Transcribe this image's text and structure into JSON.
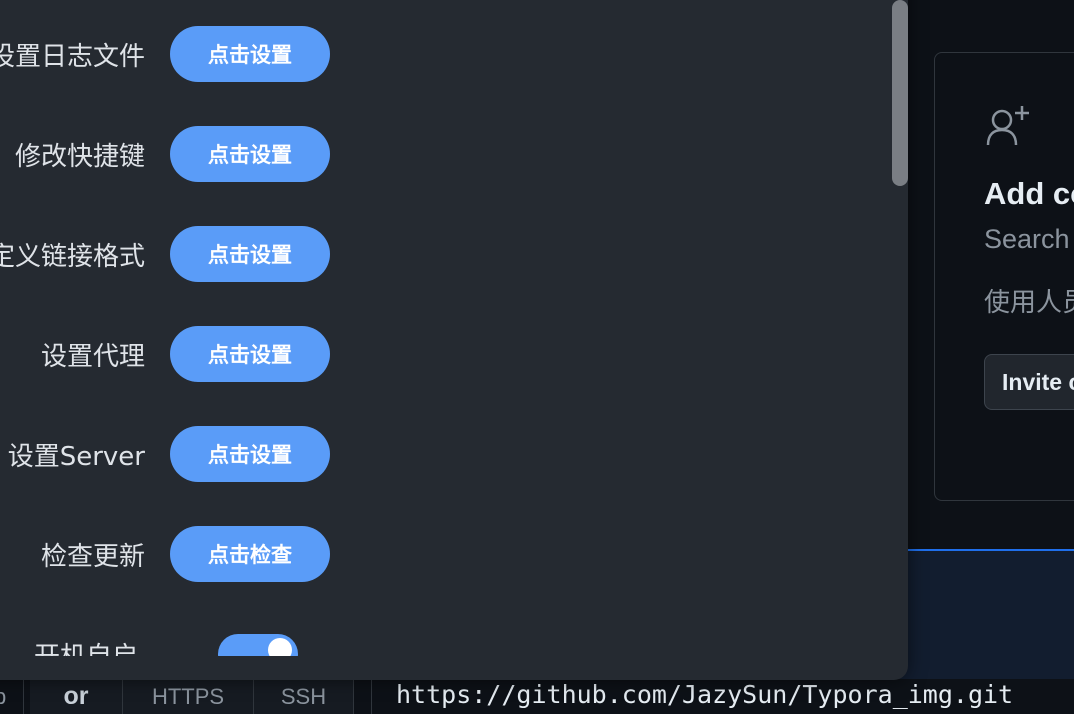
{
  "settings": {
    "rows": [
      {
        "label": "设置日志文件",
        "button": "点击设置"
      },
      {
        "label": "修改快捷键",
        "button": "点击设置"
      },
      {
        "label": "自定义链接格式",
        "button": "点击设置"
      },
      {
        "label": "设置代理",
        "button": "点击设置"
      },
      {
        "label": "设置Server",
        "button": "点击设置"
      },
      {
        "label": "检查更新",
        "button": "点击检查"
      }
    ],
    "partial_row": {
      "label": "开机自启",
      "toggle_on": true
    },
    "colors": {
      "panel_bg": "#252a31",
      "button_bg": "#5a9cf8",
      "button_text": "#ffffff",
      "label_text": "#dfe3e8"
    }
  },
  "github_card": {
    "icon": "person-plus-icon",
    "title": "Add collaborators to this repository",
    "subtitle": "Search for people using their GitHub username or email address.",
    "note": "使用人员",
    "invite_button": "Invite collaborators"
  },
  "clone_bar": {
    "prefix": "p",
    "or": "or",
    "tabs": [
      "HTTPS",
      "SSH"
    ],
    "url": "https://github.com/JazySun/Typora_img.git"
  }
}
